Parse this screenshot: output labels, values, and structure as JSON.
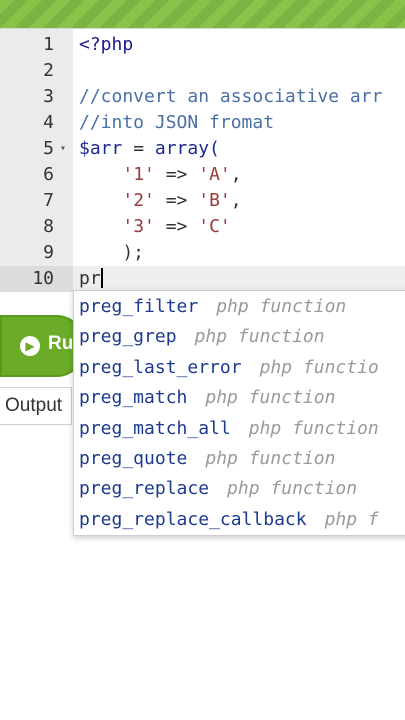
{
  "editor": {
    "lines": [
      {
        "num": "1",
        "parts": [
          {
            "t": "<?php",
            "c": "t-tag"
          }
        ]
      },
      {
        "num": "2",
        "parts": []
      },
      {
        "num": "3",
        "parts": [
          {
            "t": "//convert an associative arr",
            "c": "t-comment"
          }
        ]
      },
      {
        "num": "4",
        "parts": [
          {
            "t": "//into JSON fromat",
            "c": "t-comment"
          }
        ]
      },
      {
        "num": "5",
        "fold": true,
        "parts": [
          {
            "t": "$arr",
            "c": "t-var"
          },
          {
            "t": " = ",
            "c": ""
          },
          {
            "t": "array(",
            "c": "t-kw"
          }
        ]
      },
      {
        "num": "6",
        "parts": [
          {
            "t": "    ",
            "c": ""
          },
          {
            "t": "'1'",
            "c": "t-str"
          },
          {
            "t": " => ",
            "c": ""
          },
          {
            "t": "'A'",
            "c": "t-str"
          },
          {
            "t": ",",
            "c": ""
          }
        ]
      },
      {
        "num": "7",
        "parts": [
          {
            "t": "    ",
            "c": ""
          },
          {
            "t": "'2'",
            "c": "t-str"
          },
          {
            "t": " => ",
            "c": ""
          },
          {
            "t": "'B'",
            "c": "t-str"
          },
          {
            "t": ",",
            "c": ""
          }
        ]
      },
      {
        "num": "8",
        "parts": [
          {
            "t": "    ",
            "c": ""
          },
          {
            "t": "'3'",
            "c": "t-str"
          },
          {
            "t": " => ",
            "c": ""
          },
          {
            "t": "'C'",
            "c": "t-str"
          }
        ]
      },
      {
        "num": "9",
        "parts": [
          {
            "t": "    );",
            "c": ""
          }
        ]
      },
      {
        "num": "10",
        "active": true,
        "cursor": true,
        "parts": [
          {
            "t": "pr",
            "c": ""
          }
        ]
      }
    ]
  },
  "run_button": {
    "label": "Ru"
  },
  "output_tab": {
    "label": "Output"
  },
  "autocomplete": {
    "items": [
      {
        "name": "preg_filter",
        "type": "php function"
      },
      {
        "name": "preg_grep",
        "type": "php function"
      },
      {
        "name": "preg_last_error",
        "type": "php functio"
      },
      {
        "name": "preg_match",
        "type": "php function"
      },
      {
        "name": "preg_match_all",
        "type": "php function"
      },
      {
        "name": "preg_quote",
        "type": "php function"
      },
      {
        "name": "preg_replace",
        "type": "php function"
      },
      {
        "name": "preg_replace_callback",
        "type": "php f"
      }
    ]
  },
  "colors": {
    "banner": "#8bc34a",
    "run_button": "#6aab28",
    "suggestion": "#1c3a8f"
  }
}
